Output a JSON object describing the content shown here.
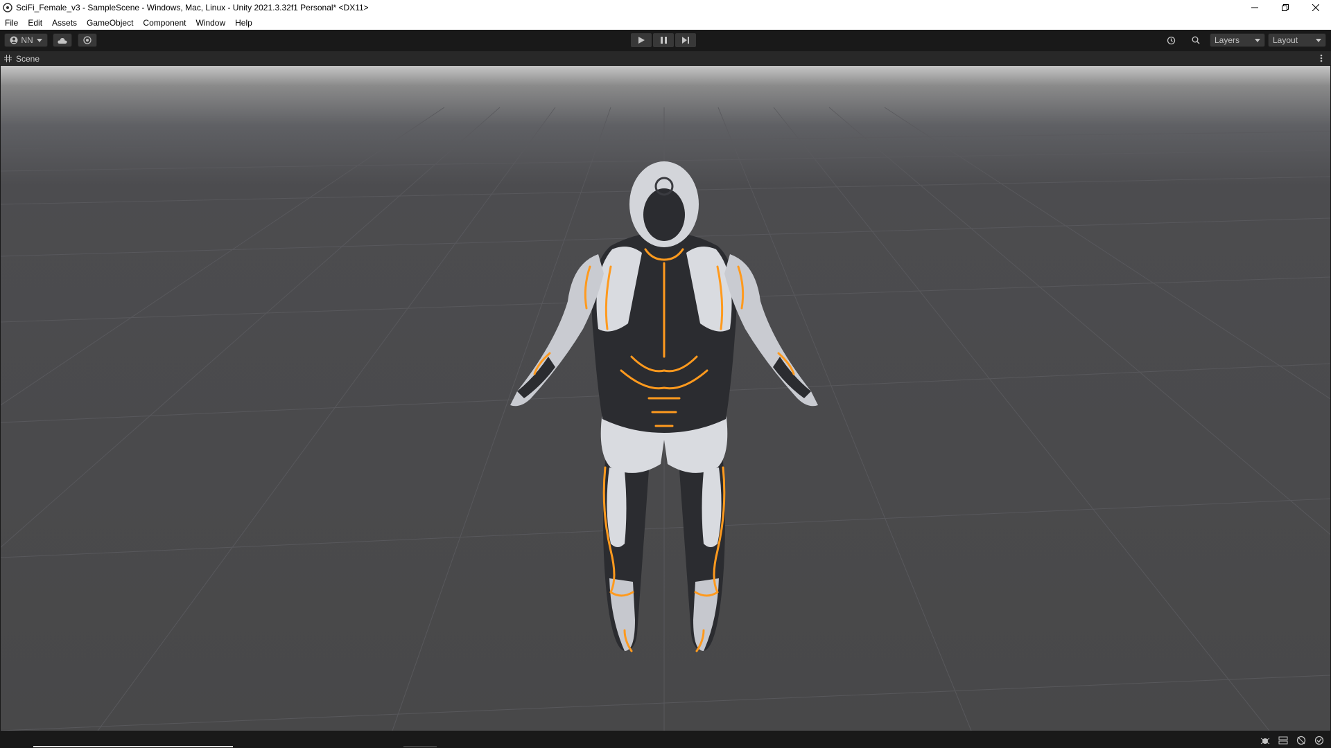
{
  "window": {
    "title": "SciFi_Female_v3 - SampleScene - Windows, Mac, Linux - Unity 2021.3.32f1 Personal* <DX11>"
  },
  "menu": {
    "items": [
      "File",
      "Edit",
      "Assets",
      "GameObject",
      "Component",
      "Window",
      "Help"
    ]
  },
  "toolbar": {
    "account_label": "NN",
    "layers_label": "Layers",
    "layout_label": "Layout"
  },
  "scene": {
    "tab_label": "Scene"
  },
  "colors": {
    "accent_glow": "#ff9a1e",
    "suit_white": "#d9dbe0",
    "suit_dark": "#2b2c30"
  }
}
